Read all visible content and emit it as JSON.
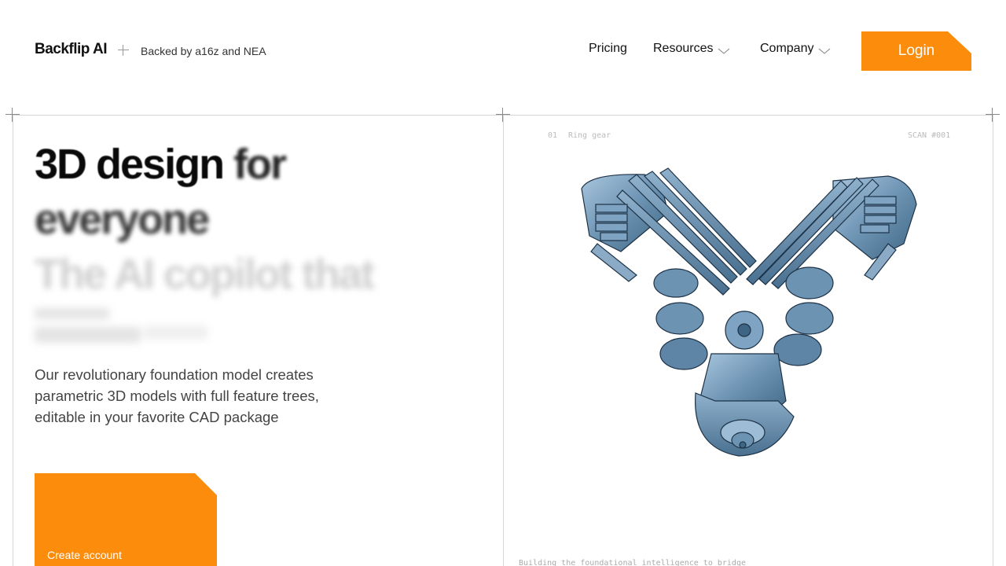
{
  "header": {
    "brand": "Backflip AI",
    "backed": "Backed by a16z and NEA",
    "nav": {
      "pricing": "Pricing",
      "resources": "Resources",
      "company": "Company"
    },
    "login": "Login"
  },
  "hero": {
    "line1_a": "3D design",
    "line1_b": "for",
    "line2": "everyone",
    "line3": "The AI copilot that",
    "subtitle": "Our revolutionary foundation model creates parametric 3D models with full feature trees, editable in your favorite CAD package",
    "cta": "Create account"
  },
  "preview": {
    "index": "01",
    "name": "Ring gear",
    "scan_id": "SCAN #001",
    "footer": "Building the foundational intelligence to bridge"
  },
  "colors": {
    "accent": "#fb8c0c",
    "engine": "#6d93b3"
  }
}
